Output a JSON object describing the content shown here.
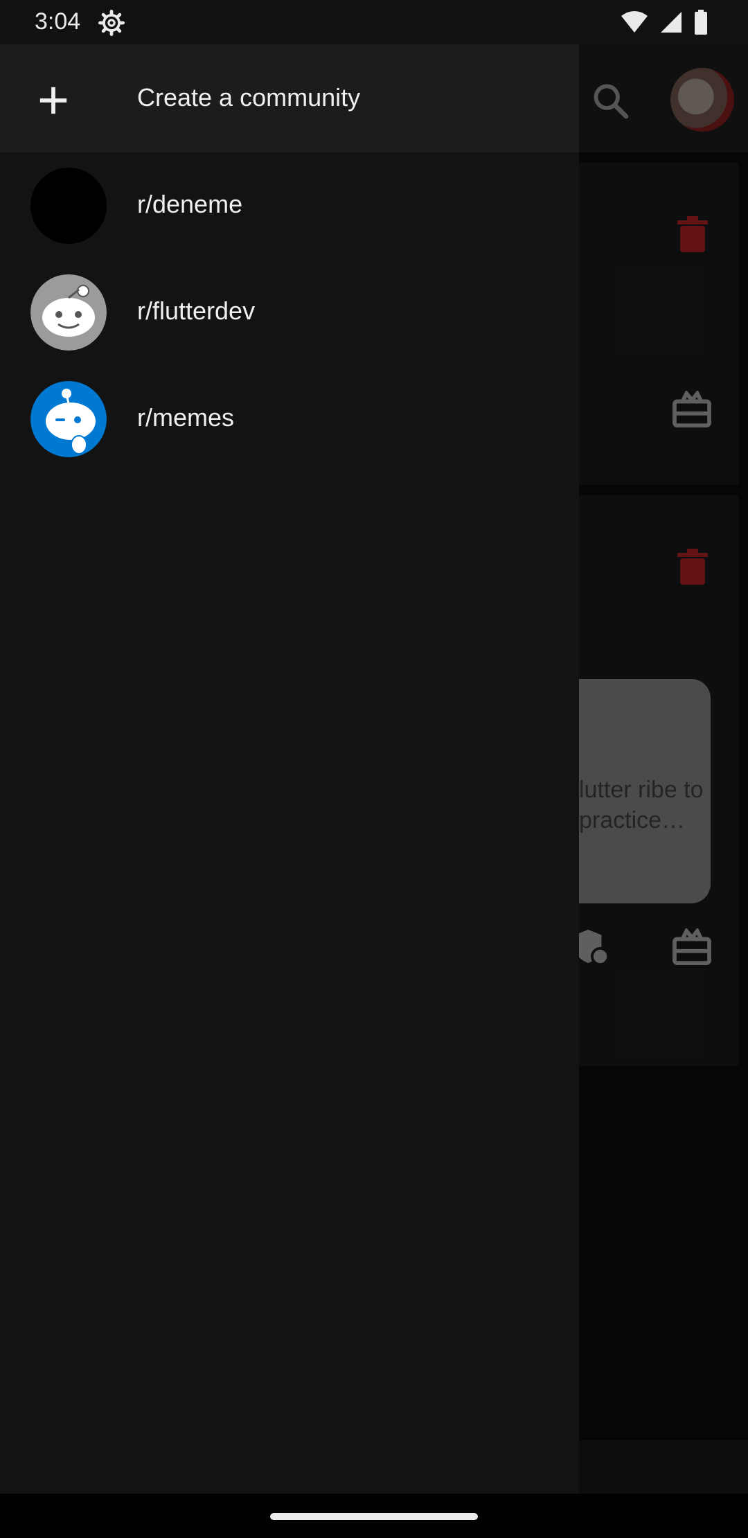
{
  "status_bar": {
    "time": "3:04",
    "icons": [
      "settings-gear-icon",
      "wifi-icon",
      "cellular-signal-icon",
      "battery-icon"
    ]
  },
  "drawer": {
    "create_label": "Create a community",
    "communities": [
      {
        "label": "r/deneme",
        "avatar": "plain-black"
      },
      {
        "label": "r/flutterdev",
        "avatar": "reddit-snoo-grey"
      },
      {
        "label": "r/memes",
        "avatar": "reddit-snoo-blue"
      }
    ]
  },
  "background": {
    "bubble_text": "lutter ribe to practice…"
  },
  "colors": {
    "drawer_bg": "#131313",
    "create_row_bg": "#1c1c1c",
    "trash_red": "#a12020",
    "memes_blue": "#0079d3"
  }
}
